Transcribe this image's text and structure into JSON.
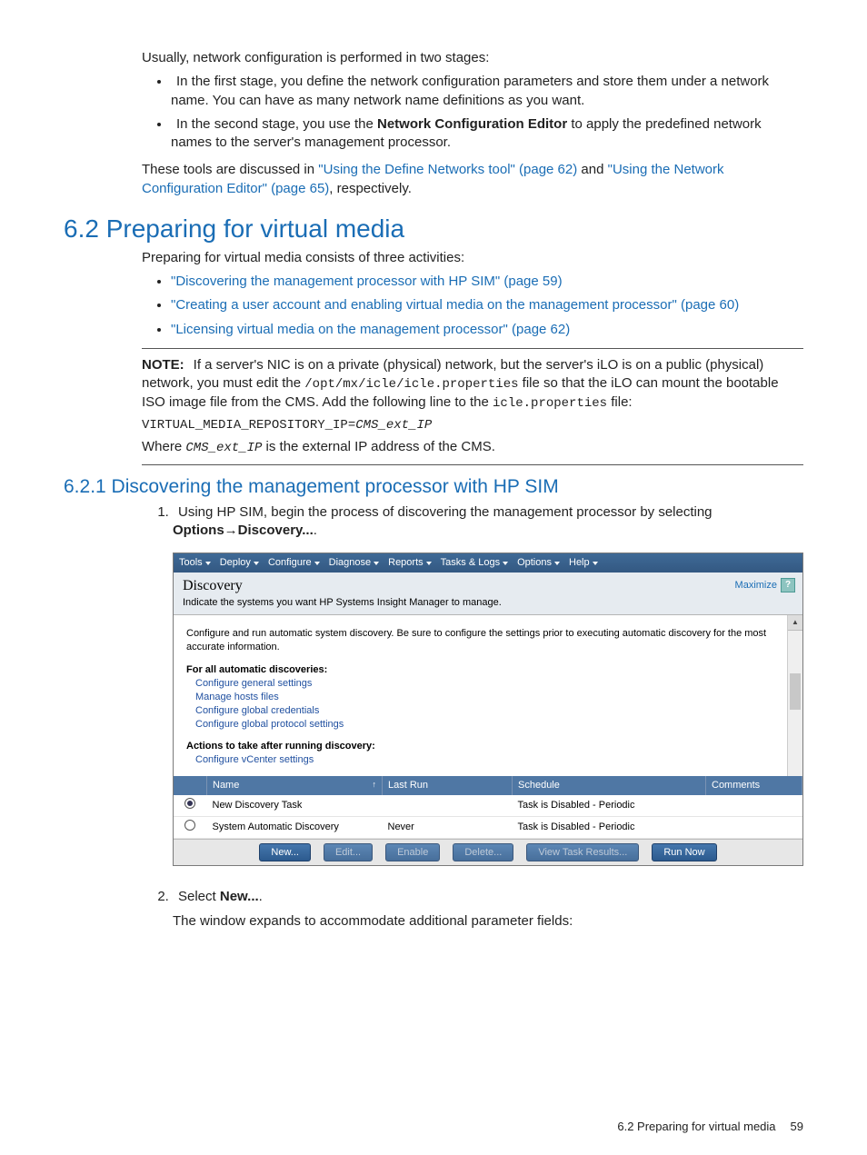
{
  "intro": {
    "stages_lead": "Usually, network configuration is performed in two stages:",
    "bullet1": "In the first stage, you define the network configuration parameters and store them under a network name. You can have as many network name definitions as you want.",
    "bullet2a": "In the second stage, you use the ",
    "bullet2b_bold": "Network Configuration Editor",
    "bullet2c": " to apply the predefined network names to the server's management processor.",
    "tools_a": "These tools are discussed in ",
    "link1": "\"Using the Define Networks tool\" (page 62)",
    "tools_b": " and ",
    "link2": "\"Using the Network Configuration Editor\" (page 65)",
    "tools_c": ", respectively."
  },
  "sec62": {
    "heading": "6.2 Preparing for virtual media",
    "lead": "Preparing for virtual media consists of three activities:",
    "b1": "\"Discovering the management processor with HP SIM\" (page 59)",
    "b2": "\"Creating a user account and enabling virtual media on the management processor\" (page 60)",
    "b3": "\"Licensing virtual media on the management processor\" (page 62)"
  },
  "note": {
    "label": "NOTE:",
    "t1": "If a server's NIC is on a private (physical) network, but the server's iLO is on a public (physical) network, you must edit the ",
    "mono1": "/opt/mx/icle/icle.properties",
    "t2": " file so that the iLO can mount the bootable ISO image file from the CMS. Add the following line to the ",
    "mono2": "icle.properties",
    "t3": " file:",
    "code_a": "VIRTUAL_MEDIA_REPOSITORY_IP=",
    "code_b": "CMS_ext_IP",
    "t4a": "Where ",
    "mono3": "CMS_ext_IP",
    "t4b": " is the external IP address of the CMS."
  },
  "sec621": {
    "heading": "6.2.1 Discovering the management processor with HP SIM",
    "step1a": "Using HP SIM, begin the process of discovering the management processor by selecting ",
    "step1b_bold": "Options→Discovery...",
    "step1c": ".",
    "step2a": "Select ",
    "step2b_bold": "New...",
    "step2c": ".",
    "step2_after": "The window expands to accommodate additional parameter fields:"
  },
  "sim": {
    "menu": [
      "Tools",
      "Deploy",
      "Configure",
      "Diagnose",
      "Reports",
      "Tasks & Logs",
      "Options",
      "Help"
    ],
    "header_title": "Discovery",
    "header_sub": "Indicate the systems you want HP Systems Insight Manager to manage.",
    "maximize": "Maximize",
    "help": "?",
    "body_intro": "Configure and run automatic system discovery. Be sure to configure the settings prior to executing automatic discovery for the most accurate information.",
    "sect1_title": "For all automatic discoveries:",
    "sect1_links": [
      "Configure general settings",
      "Manage hosts files",
      "Configure global credentials",
      "Configure global protocol settings"
    ],
    "sect2_title": "Actions to take after running discovery:",
    "sect2_links": [
      "Configure vCenter settings"
    ],
    "columns": [
      "Name",
      "Last Run",
      "Schedule",
      "Comments"
    ],
    "rows": [
      {
        "selected": true,
        "name": "New Discovery Task",
        "lastrun": "",
        "schedule": "Task is Disabled - Periodic",
        "comments": ""
      },
      {
        "selected": false,
        "name": "System Automatic Discovery",
        "lastrun": "Never",
        "schedule": "Task is Disabled - Periodic",
        "comments": ""
      }
    ],
    "buttons": [
      "New...",
      "Edit...",
      "Enable",
      "Delete...",
      "View Task Results...",
      "Run Now"
    ]
  },
  "footer": {
    "label": "6.2 Preparing for virtual media",
    "page": "59"
  }
}
